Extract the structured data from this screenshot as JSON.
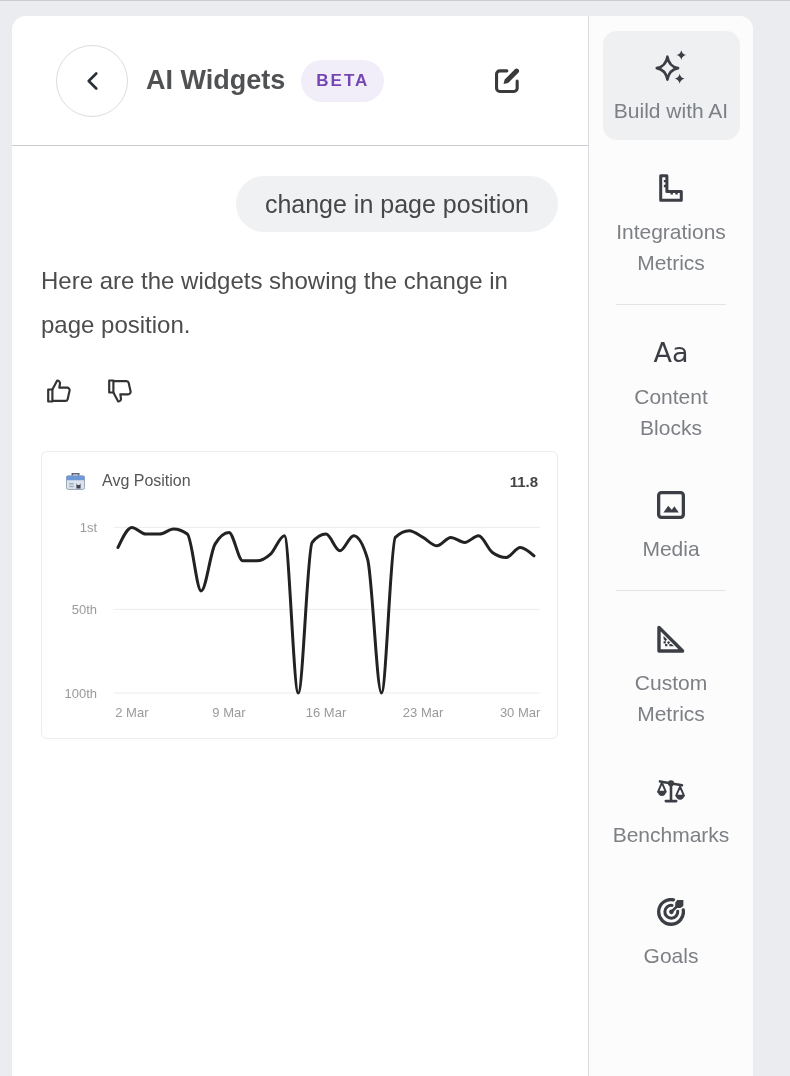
{
  "header": {
    "title": "AI Widgets",
    "badge": "BETA"
  },
  "user_message": {
    "text": "change in page position"
  },
  "reply": {
    "text": "Here are the widgets showing the change in page position.",
    "widget": {
      "title": "Avg Position",
      "value": "11.8",
      "chart_data": {
        "type": "line",
        "categories": [
          null,
          "2 Mar",
          null,
          null,
          null,
          null,
          null,
          null,
          "9 Mar",
          null,
          null,
          null,
          null,
          null,
          null,
          "16 Mar",
          null,
          null,
          null,
          null,
          null,
          null,
          "23 Mar",
          null,
          null,
          null,
          null,
          null,
          null,
          "30 Mar",
          null
        ],
        "series": [
          {
            "color": "#222222",
            "values": [
              13,
              1,
              5,
              5,
              2,
              5,
              39,
              11,
              4,
              21,
              21,
              17,
              6,
              100,
              10,
              5,
              15,
              6,
              20,
              100,
              7,
              3,
              7,
              12,
              7,
              10,
              6,
              16,
              19,
              13,
              18
            ]
          }
        ],
        "ylim": [
          100,
          1
        ],
        "yticks": [
          {
            "value": 1,
            "label": "1st"
          },
          {
            "value": 50,
            "label": "50th"
          },
          {
            "value": 100,
            "label": "100th"
          }
        ]
      }
    }
  },
  "sidebar": {
    "sections": [
      {
        "items": [
          {
            "label": "Build with AI",
            "selected": true
          },
          {
            "label": "Integrations Metrics",
            "selected": false
          }
        ]
      },
      {
        "items": [
          {
            "label": "Content Blocks",
            "icon_text": "Aa",
            "selected": false
          },
          {
            "label": "Media",
            "selected": false
          }
        ]
      },
      {
        "items": [
          {
            "label": "Custom Metrics",
            "selected": false
          },
          {
            "label": "Benchmarks",
            "selected": false
          },
          {
            "label": "Goals",
            "selected": false
          }
        ]
      }
    ]
  }
}
